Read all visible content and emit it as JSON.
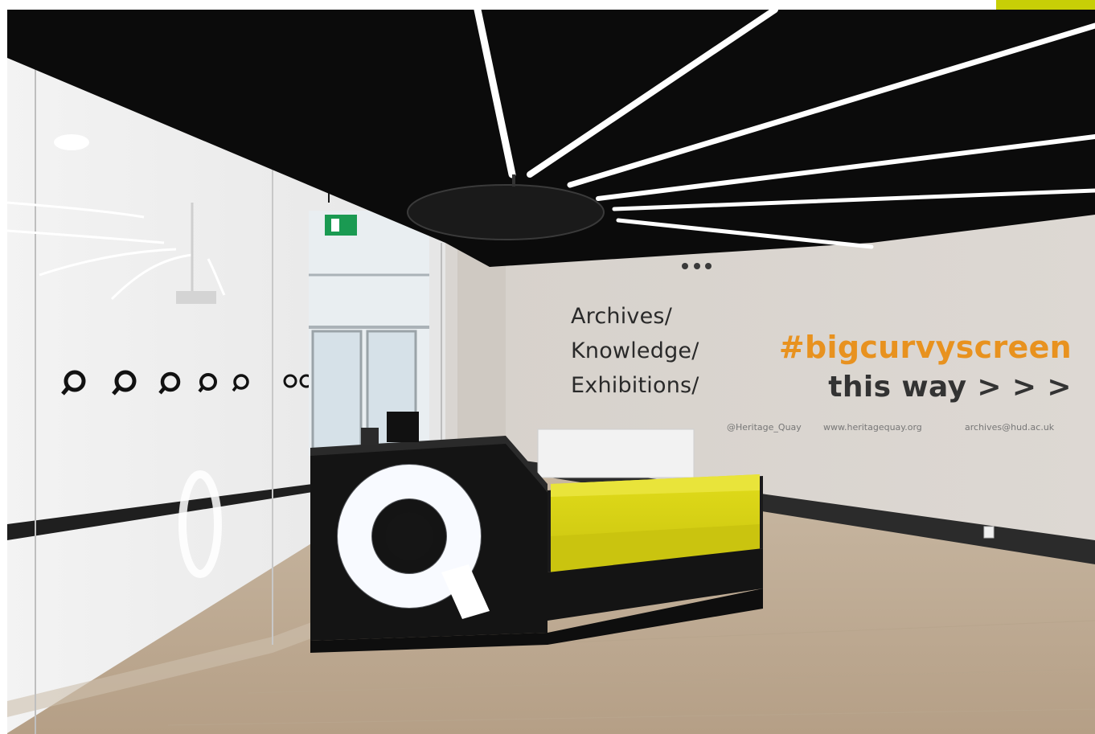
{
  "wall_text": {
    "lines": [
      "Archives/",
      "Knowledge/",
      "Exhibitions/"
    ],
    "hashtag": "#bigcurvyscreen",
    "direction": "this way > > >",
    "social": "@Heritage_Quay",
    "website": "www.heritagequay.org",
    "email": "archives@hud.ac.uk"
  },
  "colors": {
    "accent_orange": "#e8921f",
    "sofa_yellow": "#d8d314",
    "ceiling_black": "#0b0b0b",
    "floor_wood": "#c4b19a",
    "corner_tab": "#c7cf06"
  },
  "icons": {
    "desk_logo": "heritage-quay-q-logo-icon",
    "glass_decals": "q-ring-icon",
    "exit_sign": "emergency-exit-sign-icon"
  }
}
